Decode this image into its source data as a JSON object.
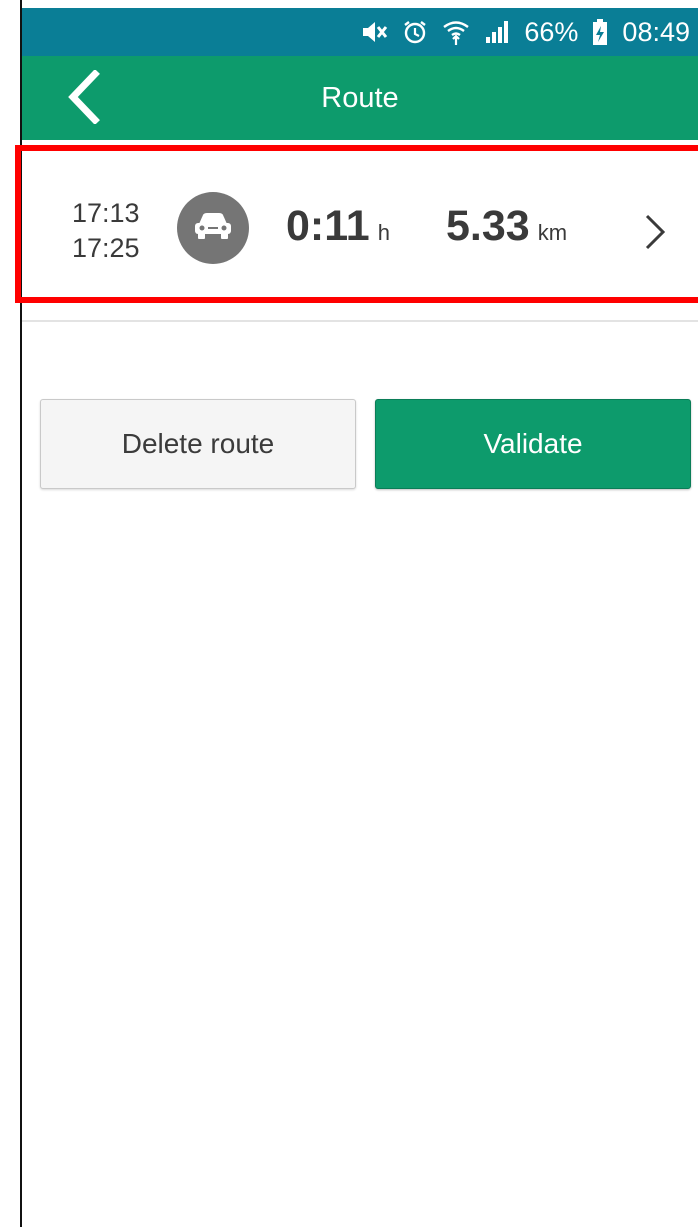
{
  "status_bar": {
    "battery_percent": "66%",
    "time": "08:49",
    "icons": [
      "mute-icon",
      "alarm-icon",
      "wifi-icon",
      "signal-icon",
      "battery-charging-icon"
    ]
  },
  "app_bar": {
    "title": "Route",
    "back_icon": "back-arrow-icon"
  },
  "route": {
    "start_time": "17:13",
    "end_time": "17:25",
    "transport_icon": "car-icon",
    "duration_value": "0:11",
    "duration_unit": "h",
    "distance_value": "5.33",
    "distance_unit": "km",
    "chevron_icon": "chevron-right-icon"
  },
  "actions": {
    "delete_label": "Delete route",
    "validate_label": "Validate"
  },
  "colors": {
    "status_bar": "#0a7e96",
    "app_bar": "#0d9b6c",
    "validate_button": "#0d9b6c",
    "highlight": "#ff0000",
    "car_circle": "#757575"
  }
}
